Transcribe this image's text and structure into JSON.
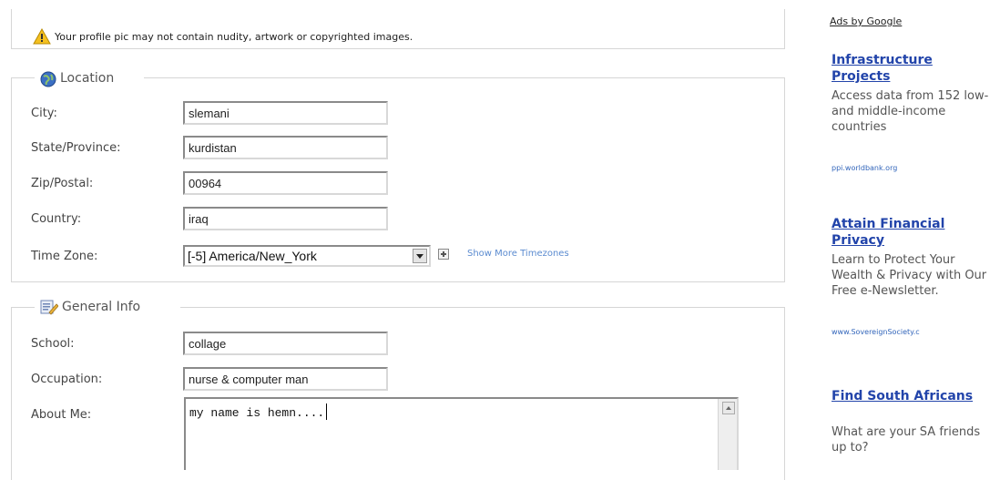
{
  "warning": {
    "text": "Your profile pic may not contain nudity, artwork or copyrighted images.",
    "icon": "warning-icon"
  },
  "location": {
    "legend": "Location",
    "icon": "globe-icon",
    "city_label": "City:",
    "city_value": "slemani",
    "state_label": "State/Province:",
    "state_value": "kurdistan",
    "zip_label": "Zip/Postal:",
    "zip_value": "00964",
    "country_label": "Country:",
    "country_value": "iraq",
    "timezone_label": "Time Zone:",
    "timezone_value": "[-5] America/New_York",
    "more_timezones": "Show More Timezones"
  },
  "general": {
    "legend": "General Info",
    "icon": "info-edit-icon",
    "school_label": "School:",
    "school_value": "collage",
    "occupation_label": "Occupation:",
    "occupation_value": "nurse & computer man",
    "about_label": "About Me:",
    "about_value": "my name is hemn...."
  },
  "ads": {
    "header": "Ads by Google",
    "items": [
      {
        "title": "Infrastructure Projects",
        "body": "Access data from 152 low- and middle-income countries",
        "url": "ppi.worldbank.org"
      },
      {
        "title": "Attain Financial Privacy",
        "body": "Learn to Protect Your Wealth & Privacy with Our Free e-Newsletter.",
        "url": "www.SovereignSociety.c"
      },
      {
        "title": "Find South Africans",
        "body": "What are your SA friends up to?"
      }
    ]
  }
}
